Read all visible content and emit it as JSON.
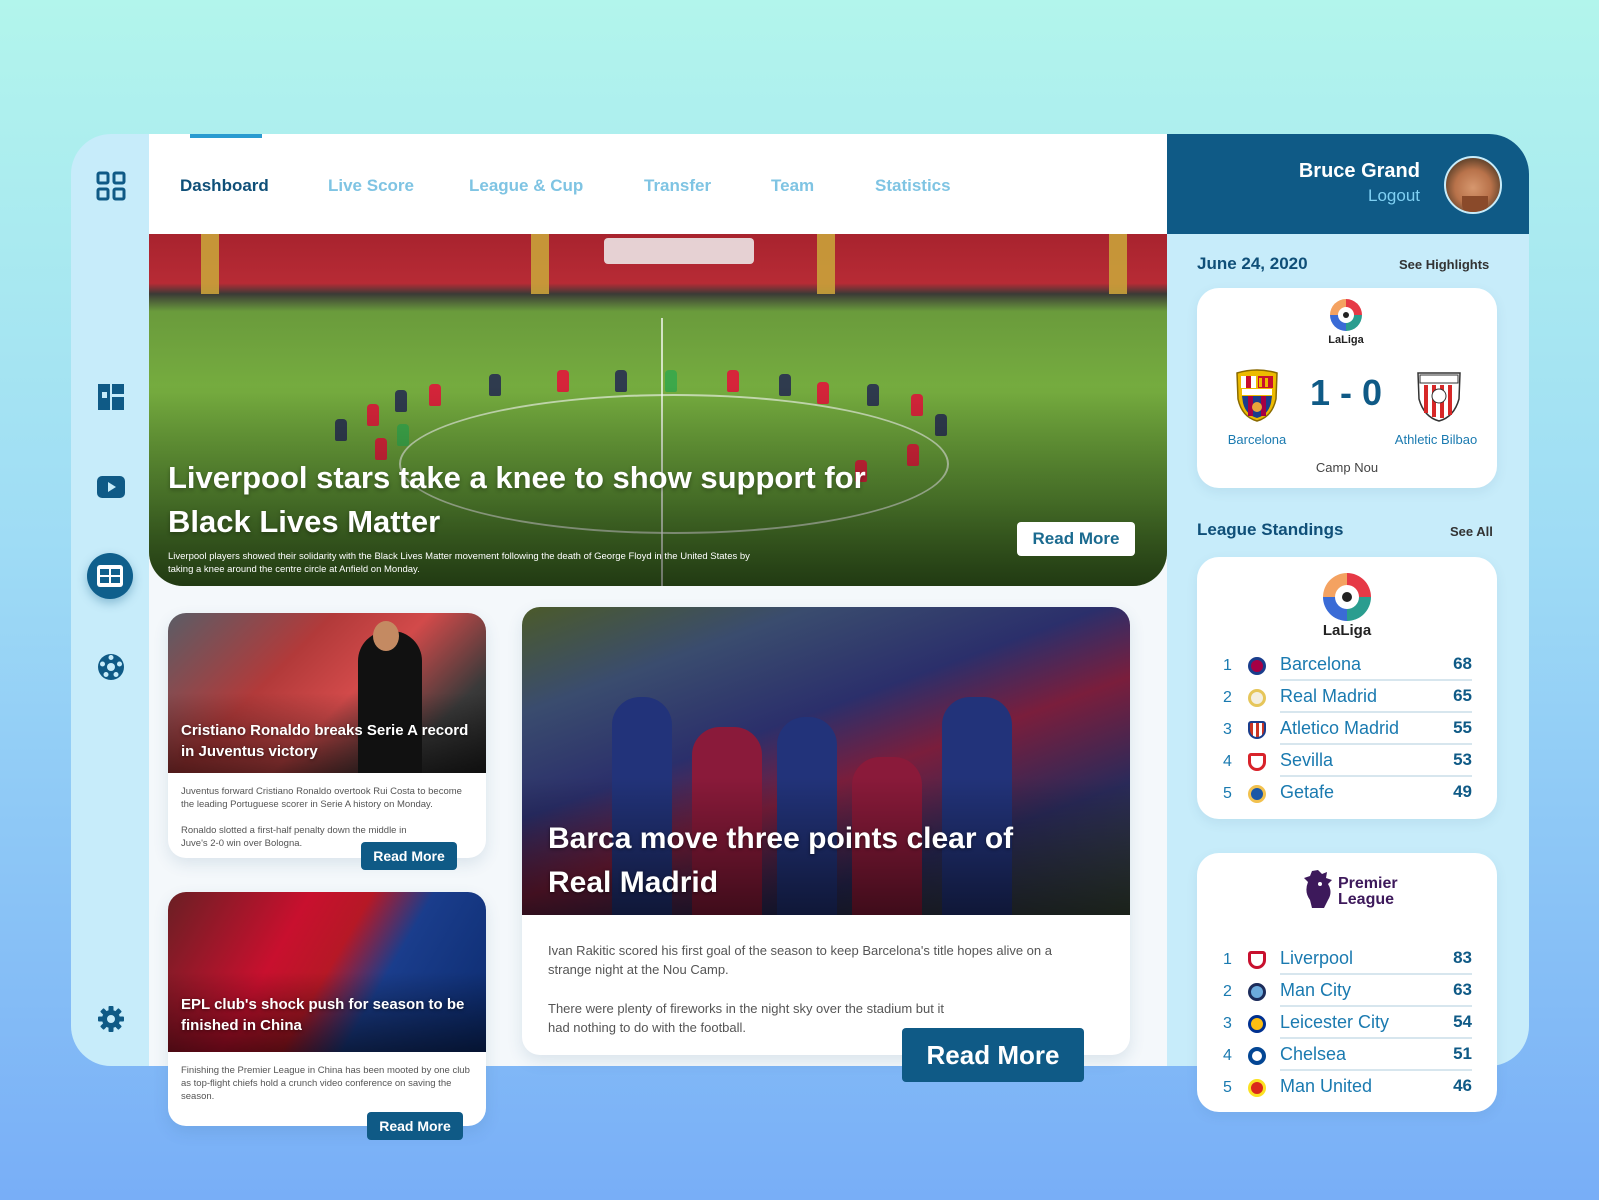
{
  "nav": {
    "items": [
      "Dashboard",
      "Live Score",
      "League & Cup",
      "Transfer",
      "Team",
      "Statistics"
    ],
    "active": "Dashboard"
  },
  "user": {
    "name": "Bruce Grand",
    "logout_label": "Logout"
  },
  "hero": {
    "title": "Liverpool stars take a knee to show support for Black Lives Matter",
    "subtitle": "Liverpool players showed their solidarity with the Black Lives Matter movement following the death of George Floyd in the United States by taking a knee around the centre circle at Anfield on Monday.",
    "button": "Read More"
  },
  "cards": [
    {
      "title": "Cristiano Ronaldo breaks Serie A record in Juventus victory",
      "body1": "Juventus forward Cristiano Ronaldo overtook Rui Costa to become the leading Portuguese scorer in Serie A history on Monday.",
      "body2": "Ronaldo slotted a first-half penalty down the middle in Juve's 2-0 win over Bologna.",
      "button": "Read More"
    },
    {
      "title": "EPL club's shock push for season to be finished in China",
      "body1": "Finishing the Premier League in China has been mooted by one club as top-flight chiefs hold a crunch video conference on saving the season.",
      "button": "Read More"
    }
  ],
  "feature": {
    "title": "Barca move three points clear of Real Madrid",
    "body1": "Ivan Rakitic scored his first goal of the season to keep Barcelona's title hopes alive on a strange night at the Nou Camp.",
    "body2": "There were plenty of fireworks in the night sky over the stadium but it had nothing to do with the football.",
    "button": "Read More"
  },
  "match": {
    "date": "June 24, 2020",
    "highlights_label": "See Highlights",
    "league": "LaLiga",
    "home": "Barcelona",
    "away": "Athletic Bilbao",
    "score": "1 - 0",
    "venue": "Camp Nou"
  },
  "standings": {
    "title": "League Standings",
    "see_all": "See All",
    "laliga": {
      "logo_text": "LaLiga",
      "rows": [
        {
          "rank": "1",
          "team": "Barcelona",
          "pts": "68",
          "color": "#a50044"
        },
        {
          "rank": "2",
          "team": "Real Madrid",
          "pts": "65",
          "color": "#e6c65a"
        },
        {
          "rank": "3",
          "team": "Atletico Madrid",
          "pts": "55",
          "color": "#cb3524"
        },
        {
          "rank": "4",
          "team": "Sevilla",
          "pts": "53",
          "color": "#d8232a"
        },
        {
          "rank": "5",
          "team": "Getafe",
          "pts": "49",
          "color": "#1a57a7"
        }
      ]
    },
    "premier": {
      "logo_text": "Premier League",
      "rows": [
        {
          "rank": "1",
          "team": "Liverpool",
          "pts": "83",
          "color": "#c8102e"
        },
        {
          "rank": "2",
          "team": "Man City",
          "pts": "63",
          "color": "#6cabdd"
        },
        {
          "rank": "3",
          "team": "Leicester City",
          "pts": "54",
          "color": "#003090"
        },
        {
          "rank": "4",
          "team": "Chelsea",
          "pts": "51",
          "color": "#034694"
        },
        {
          "rank": "5",
          "team": "Man United",
          "pts": "46",
          "color": "#da291c"
        }
      ]
    }
  }
}
